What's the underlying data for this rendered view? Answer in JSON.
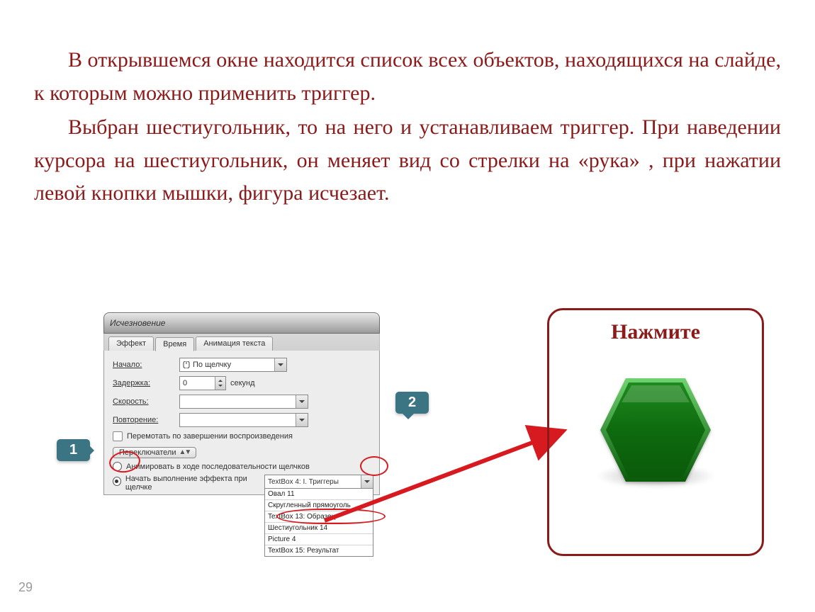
{
  "intro": {
    "p1": "В открывшемся окне находится список всех объектов, находящихся на слайде, к которым можно применить триггер.",
    "p2": "Выбран шестиугольник, то на него и устанавливаем триггер. При наведении курсора на шестиугольник, он меняет вид со стрелки на «рука» , при нажатии левой кнопки мышки, фигура исчезает."
  },
  "page_number": "29",
  "dialog": {
    "title": "Исчезновение",
    "tabs": {
      "t1": "Эффект",
      "t2": "Время",
      "t3": "Анимация текста"
    },
    "labels": {
      "start": "Начало:",
      "delay": "Задержка:",
      "speed": "Скорость:",
      "repeat": "Повторение:",
      "seconds": "секунд",
      "rewind": "Перемотать по завершении воспроизведения",
      "switches": "Переключатели"
    },
    "values": {
      "start": "По щелчку",
      "delay": "0",
      "speed": "",
      "repeat": ""
    },
    "radios": {
      "r1": "Анимировать в ходе последовательности щелчков",
      "r2": "Начать выполнение эффекта при щелчке"
    },
    "trigger_selected": "TextBox 4: I. Триггеры",
    "dropdown": {
      "o1": "Овал 11",
      "o2": "Скругленный прямоуголь",
      "o3": "TextBox 13: Образец",
      "o4": "Шестиугольник 14",
      "o5": "Picture 4",
      "o6": "TextBox 15: Результат"
    }
  },
  "callouts": {
    "c1": "1",
    "c2": "2"
  },
  "frame": {
    "title": "Нажмите"
  }
}
